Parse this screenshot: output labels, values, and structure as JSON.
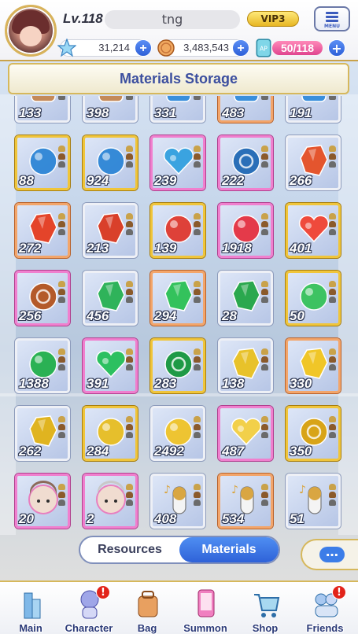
{
  "header": {
    "level": "Lv.118",
    "player_name": "tng",
    "vip": "VIP3",
    "menu_label": "MENU",
    "resources": [
      {
        "icon": "star-icon",
        "value": "31,214"
      },
      {
        "icon": "coin-icon",
        "value": "3,483,543"
      },
      {
        "icon": "stamina-icon",
        "value": "50/118"
      }
    ]
  },
  "title": "Materials Storage",
  "items": [
    {
      "count": "133",
      "frame": "silver",
      "shape": "misc",
      "color": "#c48a5a"
    },
    {
      "count": "398",
      "frame": "silver",
      "shape": "misc",
      "color": "#c48a5a"
    },
    {
      "count": "331",
      "frame": "silver",
      "shape": "misc",
      "color": "#3a8fdc"
    },
    {
      "count": "483",
      "frame": "orange",
      "shape": "misc",
      "color": "#3a8fdc"
    },
    {
      "count": "191",
      "frame": "silver",
      "shape": "misc",
      "color": "#3a8fdc"
    },
    {
      "count": "88",
      "frame": "gold",
      "shape": "orb",
      "color": "#2e86d6"
    },
    {
      "count": "924",
      "frame": "gold",
      "shape": "orb",
      "color": "#2e86d6"
    },
    {
      "count": "239",
      "frame": "pink",
      "shape": "heart",
      "color": "#3aa3e0"
    },
    {
      "count": "222",
      "frame": "pink",
      "shape": "ring",
      "color": "#2a6fb8"
    },
    {
      "count": "266",
      "frame": "silver",
      "shape": "crystal",
      "color": "#e4552e"
    },
    {
      "count": "272",
      "frame": "orange",
      "shape": "crystal",
      "color": "#e4442a"
    },
    {
      "count": "213",
      "frame": "silver",
      "shape": "crystal",
      "color": "#d9402a"
    },
    {
      "count": "139",
      "frame": "gold",
      "shape": "orb",
      "color": "#e03a30"
    },
    {
      "count": "1918",
      "frame": "pink",
      "shape": "orb",
      "color": "#e63242"
    },
    {
      "count": "401",
      "frame": "gold",
      "shape": "heart",
      "color": "#ef4a3c"
    },
    {
      "count": "256",
      "frame": "pink",
      "shape": "ring",
      "color": "#b45a2a"
    },
    {
      "count": "456",
      "frame": "silver",
      "shape": "crystal",
      "color": "#2fb35a"
    },
    {
      "count": "294",
      "frame": "orange",
      "shape": "crystal",
      "color": "#33c25c"
    },
    {
      "count": "28",
      "frame": "silver",
      "shape": "crystal",
      "color": "#2aa84e"
    },
    {
      "count": "50",
      "frame": "gold",
      "shape": "orb",
      "color": "#36c25a"
    },
    {
      "count": "1388",
      "frame": "silver",
      "shape": "orb",
      "color": "#22b04c"
    },
    {
      "count": "391",
      "frame": "pink",
      "shape": "heart",
      "color": "#2cc060"
    },
    {
      "count": "283",
      "frame": "gold",
      "shape": "ring",
      "color": "#1f9a46"
    },
    {
      "count": "138",
      "frame": "silver",
      "shape": "crystal",
      "color": "#e8c22a"
    },
    {
      "count": "330",
      "frame": "orange",
      "shape": "crystal",
      "color": "#f0c628"
    },
    {
      "count": "262",
      "frame": "silver",
      "shape": "crystal",
      "color": "#e0b420"
    },
    {
      "count": "284",
      "frame": "gold",
      "shape": "orb",
      "color": "#e8be22"
    },
    {
      "count": "2492",
      "frame": "silver",
      "shape": "orb",
      "color": "#f0c428"
    },
    {
      "count": "487",
      "frame": "pink",
      "shape": "heart",
      "color": "#f2d04a"
    },
    {
      "count": "350",
      "frame": "gold",
      "shape": "ring",
      "color": "#d8a418"
    },
    {
      "count": "20",
      "frame": "pink",
      "shape": "face",
      "color": "#8c6a5a"
    },
    {
      "count": "2",
      "frame": "pink",
      "shape": "face",
      "color": "#c8c8c8"
    },
    {
      "count": "408",
      "frame": "silver",
      "shape": "capsule",
      "color": "#d9a642"
    },
    {
      "count": "534",
      "frame": "orange",
      "shape": "capsule",
      "color": "#d9a642"
    },
    {
      "count": "51",
      "frame": "silver",
      "shape": "capsule",
      "color": "#d9a642"
    }
  ],
  "tabs": [
    {
      "label": "Resources",
      "active": false
    },
    {
      "label": "Materials",
      "active": true
    }
  ],
  "chat_label": "…",
  "nav": [
    {
      "label": "Main",
      "icon": "building-icon",
      "alert": false
    },
    {
      "label": "Character",
      "icon": "character-icon",
      "alert": true
    },
    {
      "label": "Bag",
      "icon": "bag-icon",
      "alert": false
    },
    {
      "label": "Summon",
      "icon": "phone-icon",
      "alert": false
    },
    {
      "label": "Shop",
      "icon": "cart-icon",
      "alert": false
    },
    {
      "label": "Friends",
      "icon": "friends-icon",
      "alert": true
    }
  ],
  "alert_mark": "!"
}
